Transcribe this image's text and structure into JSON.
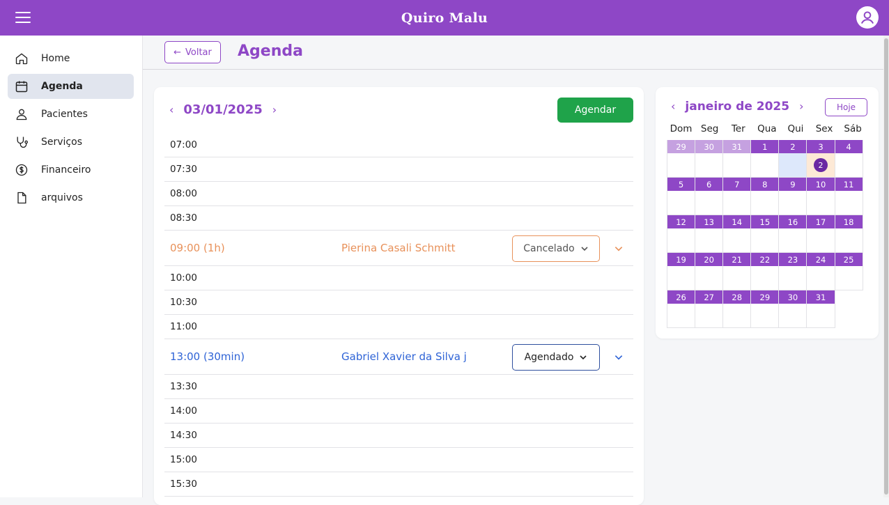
{
  "app": {
    "brand": "Quiro Malu"
  },
  "sidebar": {
    "items": [
      {
        "label": "Home",
        "icon": "home-icon"
      },
      {
        "label": "Agenda",
        "icon": "calendar-icon",
        "active": true
      },
      {
        "label": "Pacientes",
        "icon": "user-icon"
      },
      {
        "label": "Serviços",
        "icon": "stethoscope-icon"
      },
      {
        "label": "Financeiro",
        "icon": "dollar-circle-icon"
      },
      {
        "label": "arquivos",
        "icon": "file-icon"
      }
    ]
  },
  "header": {
    "back_label": "Voltar",
    "title": "Agenda"
  },
  "schedule": {
    "date": "03/01/2025",
    "agendar_label": "Agendar",
    "slots": [
      {
        "time": "07:00"
      },
      {
        "time": "07:30"
      },
      {
        "time": "08:00"
      },
      {
        "time": "08:30"
      },
      {
        "time": "09:00 (1h)",
        "patient": "Pierina Casali Schmitt",
        "status": "Cancelado",
        "color": "#e8915a"
      },
      {
        "time": "10:00"
      },
      {
        "time": "10:30"
      },
      {
        "time": "11:00"
      },
      {
        "time": "13:00 (30min)",
        "patient": "Gabriel Xavier da Silva j",
        "status": "Agendado",
        "color": "#2e63d6"
      },
      {
        "time": "13:30"
      },
      {
        "time": "14:00"
      },
      {
        "time": "14:30"
      },
      {
        "time": "15:00"
      },
      {
        "time": "15:30"
      }
    ]
  },
  "calendar": {
    "month_label": "janeiro de 2025",
    "hoje_label": "Hoje",
    "weekdays": [
      "Dom",
      "Seg",
      "Ter",
      "Qua",
      "Qui",
      "Sex",
      "Sáb"
    ],
    "weeks": [
      [
        {
          "d": "29",
          "other": true
        },
        {
          "d": "30",
          "other": true
        },
        {
          "d": "31",
          "other": true
        },
        {
          "d": "1"
        },
        {
          "d": "2",
          "today": true
        },
        {
          "d": "3",
          "selected": true,
          "count": "2"
        },
        {
          "d": "4"
        }
      ],
      [
        {
          "d": "5"
        },
        {
          "d": "6"
        },
        {
          "d": "7"
        },
        {
          "d": "8"
        },
        {
          "d": "9"
        },
        {
          "d": "10"
        },
        {
          "d": "11"
        }
      ],
      [
        {
          "d": "12"
        },
        {
          "d": "13"
        },
        {
          "d": "14"
        },
        {
          "d": "15"
        },
        {
          "d": "16"
        },
        {
          "d": "17"
        },
        {
          "d": "18"
        }
      ],
      [
        {
          "d": "19"
        },
        {
          "d": "20"
        },
        {
          "d": "21"
        },
        {
          "d": "22"
        },
        {
          "d": "23"
        },
        {
          "d": "24"
        },
        {
          "d": "25"
        }
      ],
      [
        {
          "d": "26"
        },
        {
          "d": "27"
        },
        {
          "d": "28"
        },
        {
          "d": "29"
        },
        {
          "d": "30"
        },
        {
          "d": "31"
        },
        {
          "d": ""
        }
      ]
    ]
  },
  "colors": {
    "brand": "#8e47c6",
    "success": "#1fa34a",
    "cancelled": "#e8915a",
    "scheduled": "#2e63d6"
  }
}
